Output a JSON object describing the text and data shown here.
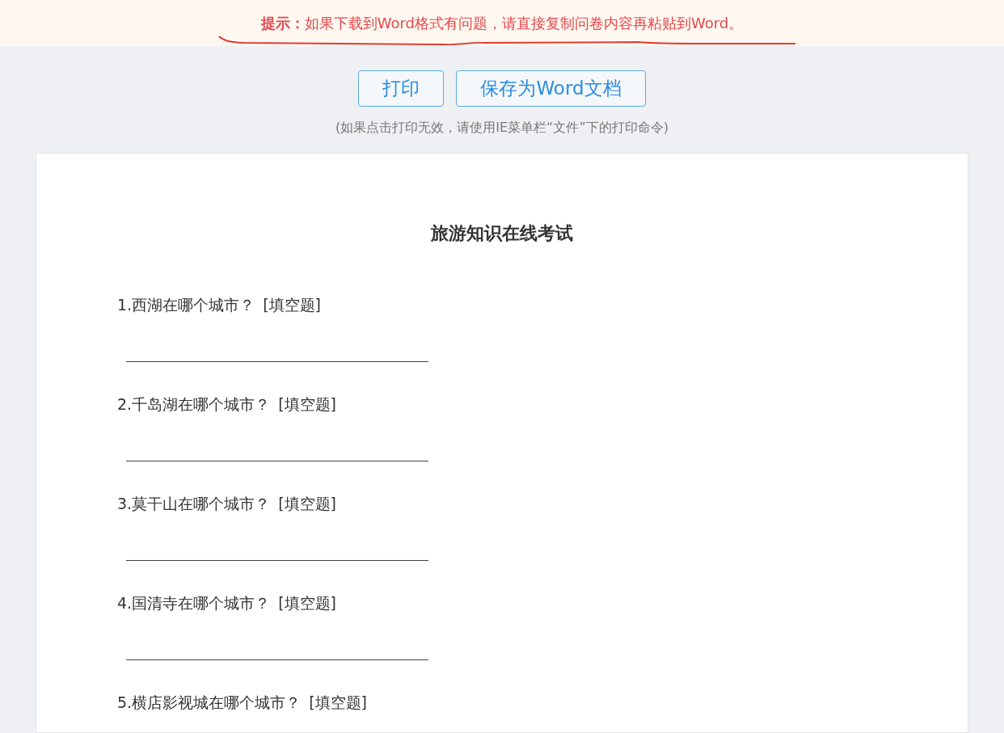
{
  "notice": {
    "label": "提示：",
    "text": "如果下载到Word格式有问题，请直接复制问卷内容再粘贴到Word。"
  },
  "buttons": [
    "打印",
    "保存为Word文档"
  ],
  "print_hint": "(如果点击打印无效，请使用IE菜单栏“文件”下的打印命令)",
  "survey": {
    "title": "旅游知识在线考试",
    "items": [
      {
        "kind": "question",
        "text": "1.西湖在哪个城市？",
        "type_label": "[填空题]"
      },
      {
        "kind": "answer_line"
      },
      {
        "kind": "question",
        "text": "2.千岛湖在哪个城市？",
        "type_label": "[填空题]"
      },
      {
        "kind": "answer_line"
      },
      {
        "kind": "question",
        "text": "3.莫干山在哪个城市？",
        "type_label": "[填空题]"
      },
      {
        "kind": "answer_line"
      },
      {
        "kind": "question",
        "text": "4.国清寺在哪个城市？",
        "type_label": "[填空题]"
      },
      {
        "kind": "answer_line"
      },
      {
        "kind": "question",
        "text": "5.横店影视城在哪个城市？",
        "type_label": "[填空题]"
      }
    ]
  }
}
